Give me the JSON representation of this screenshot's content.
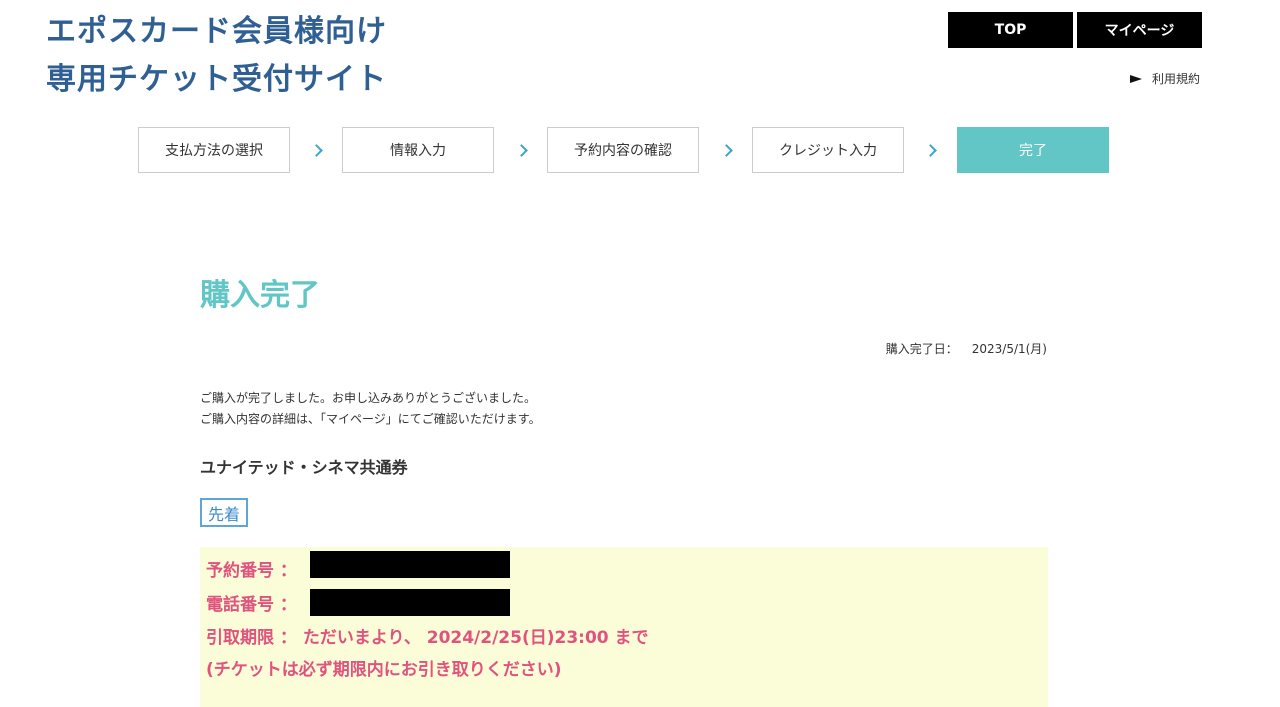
{
  "header": {
    "title_line1": "エポスカード会員様向け",
    "title_line2": "専用チケット受付サイト",
    "top_button": "TOP",
    "mypage_button": "マイページ",
    "terms_link": "利用規約"
  },
  "steps": [
    {
      "label": "支払方法の選択",
      "active": false
    },
    {
      "label": "情報入力",
      "active": false
    },
    {
      "label": "予約内容の確認",
      "active": false
    },
    {
      "label": "クレジット入力",
      "active": false
    },
    {
      "label": "完了",
      "active": true
    }
  ],
  "main": {
    "title": "購入完了",
    "purchase_date_label": "購入完了日：",
    "purchase_date_value": "2023/5/1(月)",
    "message_line1": "ご購入が完了しました。お申し込みありがとうございました。",
    "message_line2": "ご購入内容の詳細は、「マイページ」にてご確認いただけます。",
    "product_name": "ユナイテッド・シネマ共通券",
    "badge": "先着",
    "reservation_label": "予約番号 ：",
    "phone_label": "電話番号 ：",
    "pickup_line": "引取期限 ： ただいまより、 2024/2/25(日)23:00 まで",
    "pickup_note": "(チケットは必ず期限内にお引き取りください)"
  },
  "colors": {
    "title_blue": "#2f5f93",
    "accent_teal": "#62c6c6",
    "info_pink": "#e0537e",
    "info_bg": "#fbfdd8"
  }
}
